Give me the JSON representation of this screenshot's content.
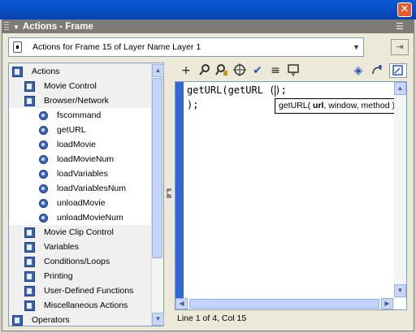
{
  "panel": {
    "title": "Actions - Frame",
    "close_glyph": "✕",
    "options_glyph": "☰",
    "target_label": "Actions for Frame 15 of Layer Name Layer 1",
    "target_icon": "frame-icon",
    "pin_glyph": "📌"
  },
  "toolbox": {
    "items": [
      {
        "label": "Actions",
        "icon": "book-icon",
        "level": 0
      },
      {
        "label": "Movie Control",
        "icon": "book-icon",
        "level": 1
      },
      {
        "label": "Browser/Network",
        "icon": "book-open-icon",
        "level": 1
      },
      {
        "label": "fscommand",
        "icon": "action-icon",
        "level": 2
      },
      {
        "label": "getURL",
        "icon": "action-icon",
        "level": 2
      },
      {
        "label": "loadMovie",
        "icon": "action-icon",
        "level": 2
      },
      {
        "label": "loadMovieNum",
        "icon": "action-icon",
        "level": 2
      },
      {
        "label": "loadVariables",
        "icon": "action-icon",
        "level": 2
      },
      {
        "label": "loadVariablesNum",
        "icon": "action-icon",
        "level": 2
      },
      {
        "label": "unloadMovie",
        "icon": "action-icon",
        "level": 2
      },
      {
        "label": "unloadMovieNum",
        "icon": "action-icon",
        "level": 2
      },
      {
        "label": "Movie Clip Control",
        "icon": "book-icon",
        "level": 1
      },
      {
        "label": "Variables",
        "icon": "book-icon",
        "level": 1
      },
      {
        "label": "Conditions/Loops",
        "icon": "book-icon",
        "level": 1
      },
      {
        "label": "Printing",
        "icon": "book-icon",
        "level": 1
      },
      {
        "label": "User-Defined Functions",
        "icon": "book-icon",
        "level": 1
      },
      {
        "label": "Miscellaneous Actions",
        "icon": "book-icon",
        "level": 1
      },
      {
        "label": "Operators",
        "icon": "book-icon",
        "level": 0
      }
    ]
  },
  "editor_toolbar": {
    "add": "+",
    "find": "🔍",
    "replace": "⚲",
    "target": "⊕",
    "check": "✔",
    "format": "≡",
    "hint": "⎚",
    "debug": "◈",
    "reference": "?",
    "view": "▤"
  },
  "editor": {
    "lines": [
      "getURL(getURL ();",
      ");"
    ],
    "tooltip_prefix": "getURL( ",
    "tooltip_bold": "url",
    "tooltip_suffix": ", window, method );"
  },
  "status": "Line 1 of 4, Col 15",
  "colors": {
    "title_bar": "#0842b0",
    "panel_header": "#7d7b76",
    "gutter": "#3268d6",
    "scroll_thumb": "#c3d3fd"
  }
}
